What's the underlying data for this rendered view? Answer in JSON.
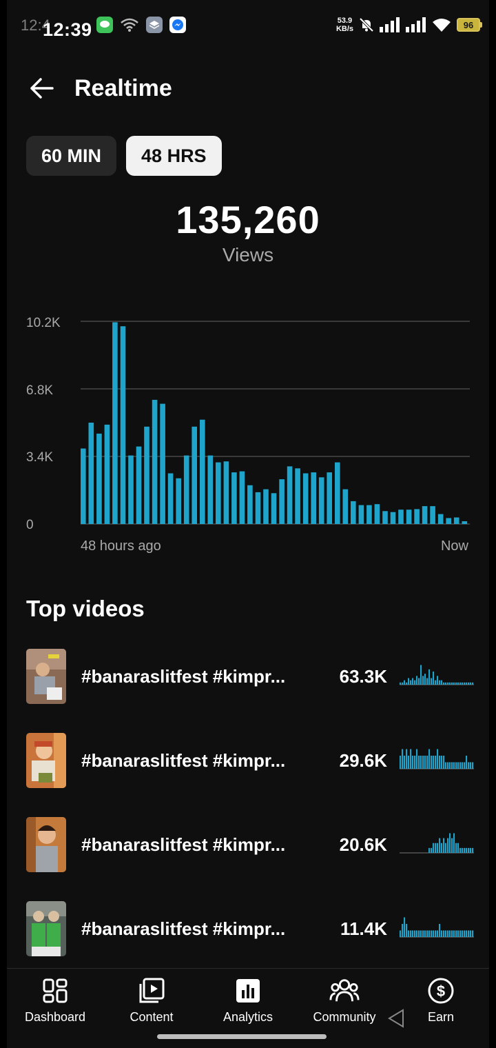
{
  "status_bar": {
    "time": "12:39",
    "ghost_time": "12:4",
    "net_speed_value": "53.9",
    "net_speed_unit": "KB/s",
    "battery": "96"
  },
  "header": {
    "back_icon": "arrow-left-icon",
    "title": "Realtime"
  },
  "toggles": [
    {
      "label": "60 MIN",
      "selected": false
    },
    {
      "label": "48 HRS",
      "selected": true
    }
  ],
  "summary": {
    "total": "135,260",
    "label": "Views"
  },
  "chart_data": {
    "type": "bar",
    "y_ticks": [
      "10.2K",
      "6.8K",
      "3.4K",
      "0"
    ],
    "ylim": [
      0,
      10200
    ],
    "x_start_label": "48 hours ago",
    "x_end_label": "Now",
    "grid": true,
    "color": "#1fa5cc",
    "values": [
      3800,
      5100,
      4550,
      5000,
      10150,
      9950,
      3450,
      3900,
      4900,
      6250,
      6050,
      2550,
      2300,
      3450,
      4900,
      5250,
      3450,
      3100,
      3150,
      2600,
      2650,
      1950,
      1600,
      1750,
      1550,
      2250,
      2900,
      2800,
      2550,
      2600,
      2350,
      2600,
      3100,
      1750,
      1150,
      950,
      950,
      1000,
      650,
      600,
      720,
      720,
      750,
      900,
      900,
      500,
      300,
      330,
      140
    ]
  },
  "top_videos": {
    "title": "Top videos",
    "items": [
      {
        "title": "#banaraslitfest #kimpr...",
        "views": "63.3K",
        "spark": [
          1,
          1,
          2,
          1,
          3,
          2,
          3,
          2,
          4,
          3,
          9,
          4,
          5,
          3,
          7,
          3,
          6,
          2,
          4,
          2,
          2,
          1,
          1,
          1,
          1,
          1,
          1,
          1,
          1,
          1,
          1,
          1,
          1,
          1,
          1,
          1
        ]
      },
      {
        "title": "#banaraslitfest #kimpr...",
        "views": "29.6K",
        "spark": [
          2,
          3,
          2,
          3,
          2,
          3,
          2,
          2,
          3,
          2,
          2,
          2,
          2,
          2,
          3,
          2,
          2,
          2,
          3,
          2,
          2,
          2,
          1,
          1,
          1,
          1,
          1,
          1,
          1,
          1,
          1,
          1,
          2,
          1,
          1,
          1
        ]
      },
      {
        "title": "#banaraslitfest #kimpr...",
        "views": "20.6K",
        "spark": [
          0,
          0,
          0,
          0,
          0,
          0,
          0,
          0,
          0,
          0,
          0,
          0,
          0,
          0,
          1,
          1,
          2,
          2,
          2,
          3,
          2,
          3,
          2,
          3,
          4,
          3,
          4,
          2,
          2,
          1,
          1,
          1,
          1,
          1,
          1,
          1
        ]
      },
      {
        "title": "#banaraslitfest #kimpr...",
        "views": "11.4K",
        "spark": [
          1,
          2,
          3,
          2,
          1,
          1,
          1,
          1,
          1,
          1,
          1,
          1,
          1,
          1,
          1,
          1,
          1,
          1,
          1,
          2,
          1,
          1,
          1,
          1,
          1,
          1,
          1,
          1,
          1,
          1,
          1,
          1,
          1,
          1,
          1,
          1
        ]
      }
    ]
  },
  "bottom_nav": [
    {
      "label": "Dashboard",
      "icon": "dashboard-icon"
    },
    {
      "label": "Content",
      "icon": "content-icon"
    },
    {
      "label": "Analytics",
      "icon": "analytics-icon",
      "selected": true
    },
    {
      "label": "Community",
      "icon": "community-icon"
    },
    {
      "label": "Earn",
      "icon": "earn-icon"
    }
  ]
}
